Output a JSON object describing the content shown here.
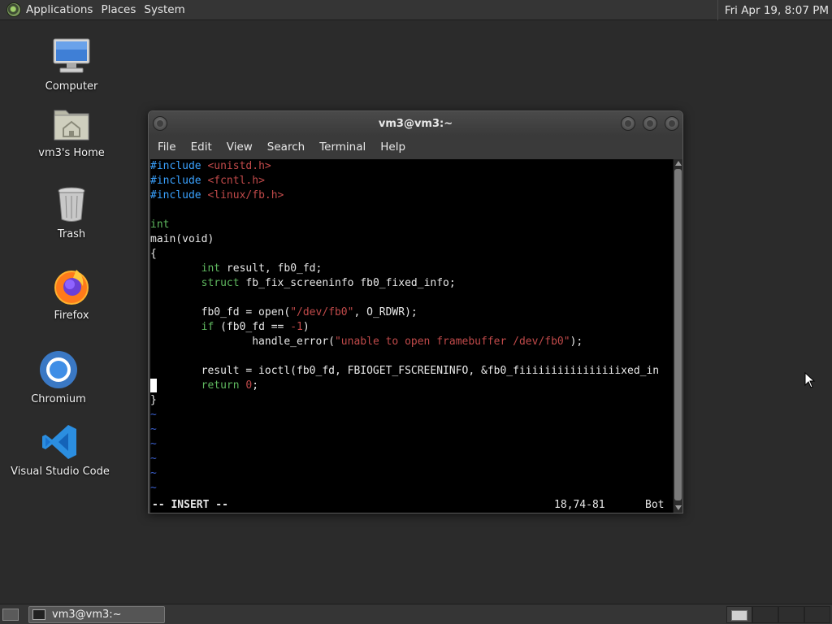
{
  "top_panel": {
    "menus": [
      "Applications",
      "Places",
      "System"
    ],
    "clock": "Fri Apr 19,  8:07 PM"
  },
  "desktop": {
    "icons": [
      {
        "label": "Computer",
        "icon": "computer-icon"
      },
      {
        "label": "vm3's Home",
        "icon": "home-folder-icon"
      },
      {
        "label": "Trash",
        "icon": "trash-icon"
      },
      {
        "label": "Firefox",
        "icon": "firefox-icon"
      },
      {
        "label": "Chromium",
        "icon": "chromium-icon"
      },
      {
        "label": "Visual Studio Code",
        "icon": "vscode-icon"
      }
    ]
  },
  "terminal": {
    "title": "vm3@vm3:~",
    "menu": [
      "File",
      "Edit",
      "View",
      "Search",
      "Terminal",
      "Help"
    ],
    "lines": [
      "#include <unistd.h>",
      "#include <fcntl.h>",
      "#include <linux/fb.h>",
      "",
      "int",
      "main(void)",
      "{",
      "        int result, fb0_fd;",
      "        struct fb_fix_screeninfo fb0_fixed_info;",
      "",
      "        fb0_fd = open(\"/dev/fb0\", O_RDWR);",
      "        if (fb0_fd == -1)",
      "                handle_error(\"unable to open framebuffer /dev/fb0\");",
      "",
      "        result = ioctl(fb0_fd, FBIOGET_FSCREENINFO, &fb0_fiiiiiiiiiiiiiiiixed_in",
      "        return 0;",
      "}",
      "~",
      "~",
      "~",
      "~",
      "~",
      "~"
    ],
    "status": {
      "mode": "-- INSERT --",
      "position": "18,74-81",
      "scroll": "Bot"
    }
  },
  "bottom_panel": {
    "task": "vm3@vm3:~"
  },
  "colors": {
    "desktop_bg": "#2b2b2b",
    "keyword": "#5fb85f",
    "preprocessor": "#3aa2ff",
    "string": "#c14a4a",
    "tilde": "#3a5fcd"
  }
}
